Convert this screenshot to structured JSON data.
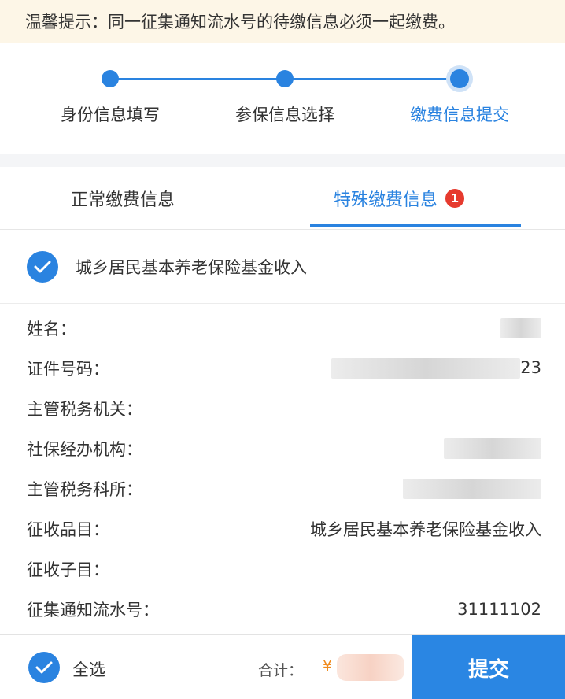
{
  "notice": "温馨提示：同一征集通知流水号的待缴信息必须一起缴费。",
  "steps": [
    {
      "label": "身份信息填写"
    },
    {
      "label": "参保信息选择"
    },
    {
      "label": "缴费信息提交"
    }
  ],
  "tabs": {
    "normal": "正常缴费信息",
    "special": "特殊缴费信息",
    "special_badge": "1"
  },
  "category": {
    "label": "城乡居民基本养老保险基金收入"
  },
  "info": {
    "name_label": "姓名：",
    "id_label": "证件号码：",
    "id_value_tail": "23",
    "tax_authority_label": "主管税务机关：",
    "social_agency_label": "社保经办机构：",
    "tax_office_label": "主管税务科所：",
    "item_label": "征收品目：",
    "item_value": "城乡居民基本养老保险基金收入",
    "sub_item_label": "征收子目：",
    "serial_label": "征集通知流水号：",
    "serial_value": "31111102"
  },
  "footer": {
    "select_all": "全选",
    "total_label": "合计：",
    "currency": "¥",
    "submit": "提交"
  },
  "colors": {
    "accent": "#2a83e0",
    "badge": "#e63a2e",
    "notice_bg": "#fdf6e7",
    "currency": "#f08a1c"
  }
}
